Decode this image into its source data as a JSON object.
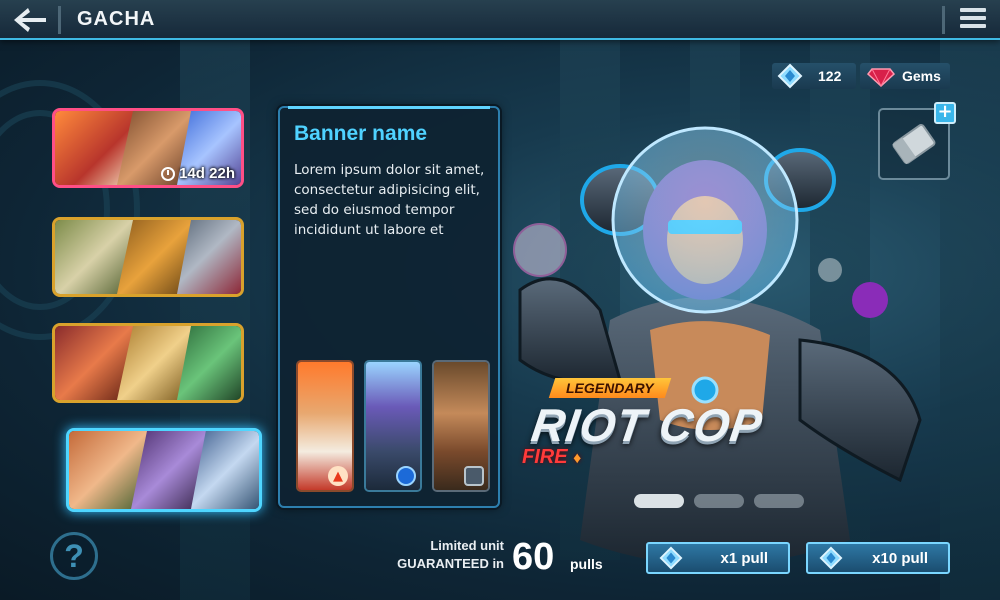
{
  "header": {
    "title": "GACHA"
  },
  "currency": {
    "crystals": {
      "icon": "blue-crystal-icon",
      "value": "122"
    },
    "gems": {
      "icon": "red-gem-icon",
      "label": "Gems"
    }
  },
  "banners": [
    {
      "state": "timed",
      "timer": "14d 22h",
      "border": "#ff4f86"
    },
    {
      "state": "normal",
      "border": "#d9a22c"
    },
    {
      "state": "normal",
      "border": "#d9a22c"
    },
    {
      "state": "selected",
      "border": "#4fd6ff"
    }
  ],
  "info_panel": {
    "name": "Banner name",
    "description": "Lorem ipsum dolor sit amet, consectetur adipisicing elit, sed do eiusmod tempor incididunt ut labore et",
    "featured_units": [
      {
        "element_icon": "fire-icon"
      },
      {
        "element_icon": "water-orb-icon"
      },
      {
        "element_icon": "steel-nut-icon"
      }
    ]
  },
  "hero": {
    "rarity": "LEGENDARY",
    "name": "RIOT COP",
    "element": "FIRE"
  },
  "carousel": {
    "pages": 3,
    "active": 0
  },
  "guarantee": {
    "line1": "Limited unit",
    "line2": "GUARANTEED in",
    "count": "60",
    "unit": "pulls"
  },
  "pull_buttons": {
    "single": "x1 pull",
    "multi": "x10 pull"
  },
  "help": {
    "label": "?"
  },
  "colors": {
    "accent": "#4fd2ff",
    "gold": "#d9a22c",
    "pink": "#ff4f86",
    "legendary": "#ffb02e",
    "fire": "#ff3a3a"
  }
}
